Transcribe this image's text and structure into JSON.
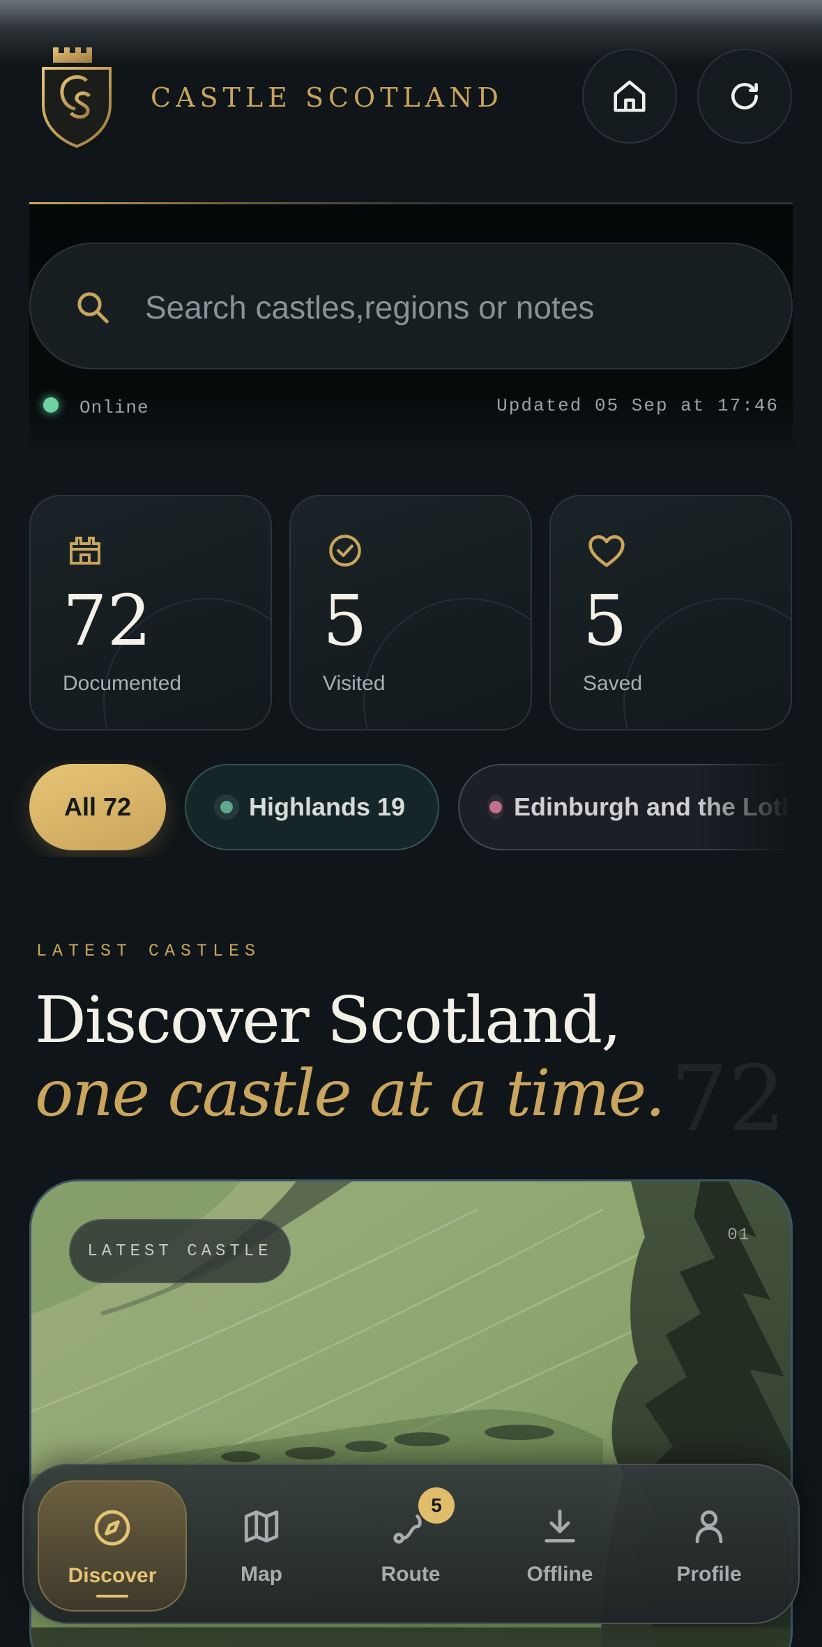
{
  "header": {
    "brand": "CASTLE SCOTLAND",
    "logo_icon": "castle-cs-crest",
    "home_icon": "home-icon",
    "refresh_icon": "refresh-icon"
  },
  "search": {
    "placeholder": "Search castles,regions or notes",
    "value": ""
  },
  "status": {
    "connection": "Online",
    "updated": "Updated 05 Sep at 17:46"
  },
  "stats": [
    {
      "icon": "castle-icon",
      "value": "72",
      "label": "Documented"
    },
    {
      "icon": "check-circle-icon",
      "value": "5",
      "label": "Visited"
    },
    {
      "icon": "heart-icon",
      "value": "5",
      "label": "Saved"
    }
  ],
  "filters": {
    "all": "All 72",
    "highlands": "Highlands 19",
    "edinburgh": "Edinburgh and the Lothians"
  },
  "latest": {
    "eyebrow": "LATEST CASTLES",
    "headline": "Discover Scotland,",
    "headline_italic": "one castle at a time.",
    "count": "72"
  },
  "card": {
    "tag": "LATEST CASTLE",
    "index": "01"
  },
  "nav": {
    "items": [
      {
        "label": "Discover",
        "icon": "compass-icon"
      },
      {
        "label": "Map",
        "icon": "map-icon"
      },
      {
        "label": "Route",
        "icon": "route-icon",
        "badge": "5"
      },
      {
        "label": "Offline",
        "icon": "download-icon"
      },
      {
        "label": "Profile",
        "icon": "user-icon"
      }
    ]
  },
  "colors": {
    "background": "#0f1518",
    "gold": "#c9a55d",
    "online": "#6fd2a2",
    "highlands": "#5fa88c",
    "edinburgh": "#c2708f"
  }
}
